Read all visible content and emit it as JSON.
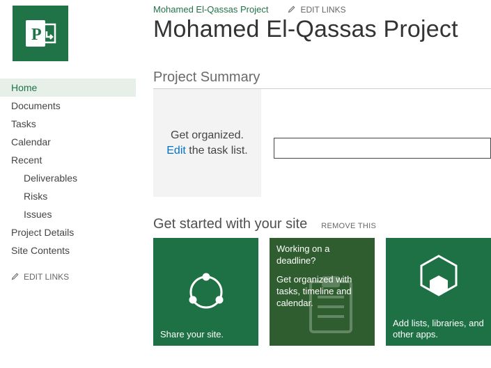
{
  "breadcrumb": "Mohamed El-Qassas Project",
  "edit_links_label": "EDIT LINKS",
  "page_title": "Mohamed El-Qassas Project",
  "nav": {
    "home": "Home",
    "documents": "Documents",
    "tasks": "Tasks",
    "calendar": "Calendar",
    "recent": "Recent",
    "deliverables": "Deliverables",
    "risks": "Risks",
    "issues": "Issues",
    "project_details": "Project Details",
    "site_contents": "Site Contents"
  },
  "summary": {
    "title": "Project Summary",
    "promo_pre": "Get organized. ",
    "promo_link": "Edit",
    "promo_post": " the task list."
  },
  "getstarted": {
    "title": "Get started with your site",
    "remove": "REMOVE THIS",
    "tile1_caption": "Share your site.",
    "tile2_top_a": "Working on a deadline?",
    "tile2_top_b": "Get organized with tasks, timeline and calendar.",
    "tile3_caption": "Add lists, libraries, and other apps."
  }
}
